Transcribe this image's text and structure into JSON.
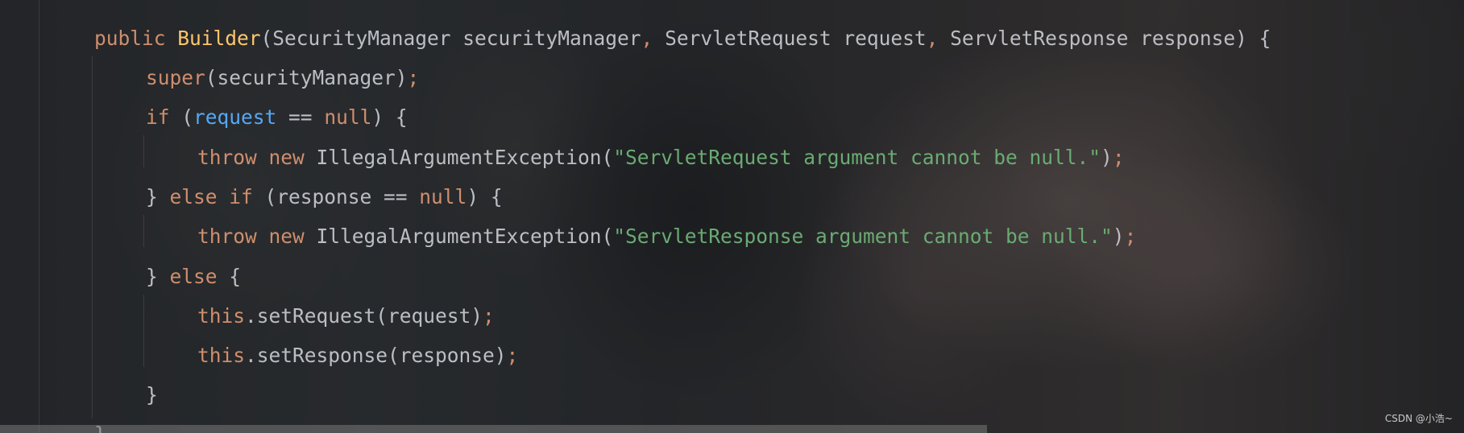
{
  "editor": {
    "lines": [
      {
        "tokens": [
          {
            "t": "public ",
            "c": "kw"
          },
          {
            "t": "Builder",
            "c": "fn"
          },
          {
            "t": "(SecurityManager securityManager",
            "c": "plain"
          },
          {
            "t": ", ",
            "c": "punct"
          },
          {
            "t": "ServletRequest request",
            "c": "plain"
          },
          {
            "t": ", ",
            "c": "punct"
          },
          {
            "t": "ServletResponse response) {",
            "c": "plain"
          }
        ]
      },
      {
        "tokens": [
          {
            "t": "super",
            "c": "kw"
          },
          {
            "t": "(securityManager)",
            "c": "plain"
          },
          {
            "t": ";",
            "c": "punct"
          }
        ]
      },
      {
        "tokens": [
          {
            "t": "if ",
            "c": "kw"
          },
          {
            "t": "(",
            "c": "plain"
          },
          {
            "t": "request",
            "c": "var"
          },
          {
            "t": " == ",
            "c": "plain"
          },
          {
            "t": "null",
            "c": "kw"
          },
          {
            "t": ") {",
            "c": "plain"
          }
        ]
      },
      {
        "tokens": [
          {
            "t": "throw new ",
            "c": "kw"
          },
          {
            "t": "IllegalArgumentException(",
            "c": "plain"
          },
          {
            "t": "\"ServletRequest argument cannot be null.\"",
            "c": "str"
          },
          {
            "t": ")",
            "c": "plain"
          },
          {
            "t": ";",
            "c": "punct"
          }
        ]
      },
      {
        "tokens": [
          {
            "t": "} ",
            "c": "plain"
          },
          {
            "t": "else if ",
            "c": "kw"
          },
          {
            "t": "(response == ",
            "c": "plain"
          },
          {
            "t": "null",
            "c": "kw"
          },
          {
            "t": ") {",
            "c": "plain"
          }
        ]
      },
      {
        "tokens": [
          {
            "t": "throw new ",
            "c": "kw"
          },
          {
            "t": "IllegalArgumentException(",
            "c": "plain"
          },
          {
            "t": "\"ServletResponse argument cannot be null.\"",
            "c": "str"
          },
          {
            "t": ")",
            "c": "plain"
          },
          {
            "t": ";",
            "c": "punct"
          }
        ]
      },
      {
        "tokens": [
          {
            "t": "} ",
            "c": "plain"
          },
          {
            "t": "else ",
            "c": "kw"
          },
          {
            "t": "{",
            "c": "plain"
          }
        ]
      },
      {
        "tokens": [
          {
            "t": "this",
            "c": "kw"
          },
          {
            "t": ".setRequest(request)",
            "c": "plain"
          },
          {
            "t": ";",
            "c": "punct"
          }
        ]
      },
      {
        "tokens": [
          {
            "t": "this",
            "c": "kw"
          },
          {
            "t": ".setResponse(response)",
            "c": "plain"
          },
          {
            "t": ";",
            "c": "punct"
          }
        ]
      },
      {
        "tokens": [
          {
            "t": "}",
            "c": "plain"
          }
        ]
      },
      {
        "tokens": [
          {
            "t": "}",
            "c": "plain"
          }
        ]
      }
    ]
  },
  "watermark": "CSDN @小浩~",
  "colors": {
    "keyword": "#cf8e6d",
    "function": "#ffc66d",
    "string": "#6aab73",
    "variable": "#56a8f5",
    "text": "#bcbec4",
    "background": "#2b2d30"
  }
}
